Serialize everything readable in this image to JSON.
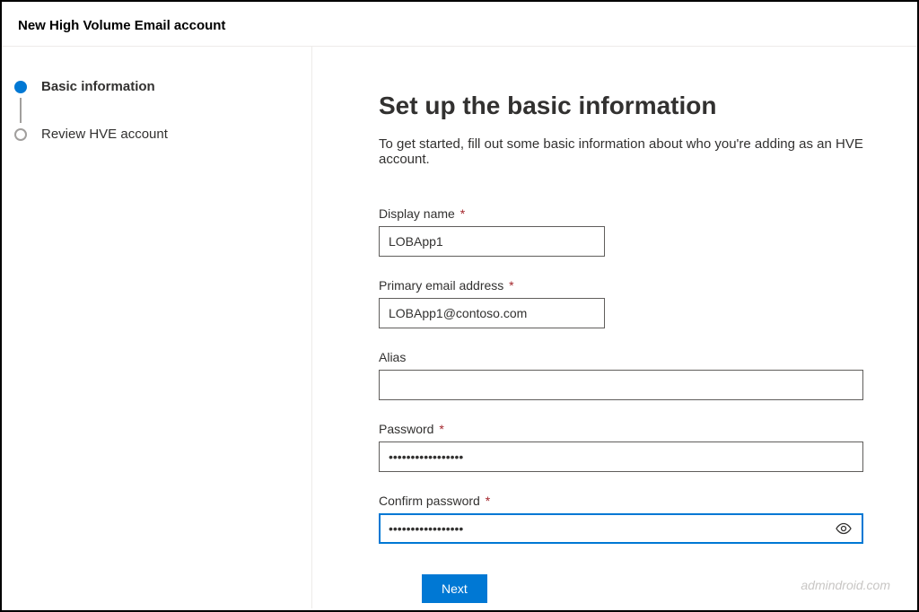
{
  "header": {
    "title": "New High Volume Email account"
  },
  "sidebar": {
    "steps": [
      {
        "label": "Basic information",
        "active": true
      },
      {
        "label": "Review HVE account",
        "active": false
      }
    ]
  },
  "content": {
    "title": "Set up the basic information",
    "subtitle": "To get started, fill out some basic information about who you're adding as an HVE account."
  },
  "form": {
    "display_name": {
      "label": "Display name",
      "value": "LOBApp1",
      "required": true
    },
    "primary_email": {
      "label": "Primary email address",
      "value": "LOBApp1@contoso.com",
      "required": true
    },
    "alias": {
      "label": "Alias",
      "value": "",
      "required": false
    },
    "password": {
      "label": "Password",
      "value": "•••••••••••••••••",
      "required": true
    },
    "confirm_password": {
      "label": "Confirm password",
      "value": "•••••••••••••••••",
      "required": true
    }
  },
  "buttons": {
    "next": "Next"
  },
  "required_marker": "*",
  "watermark": "admindroid.com"
}
